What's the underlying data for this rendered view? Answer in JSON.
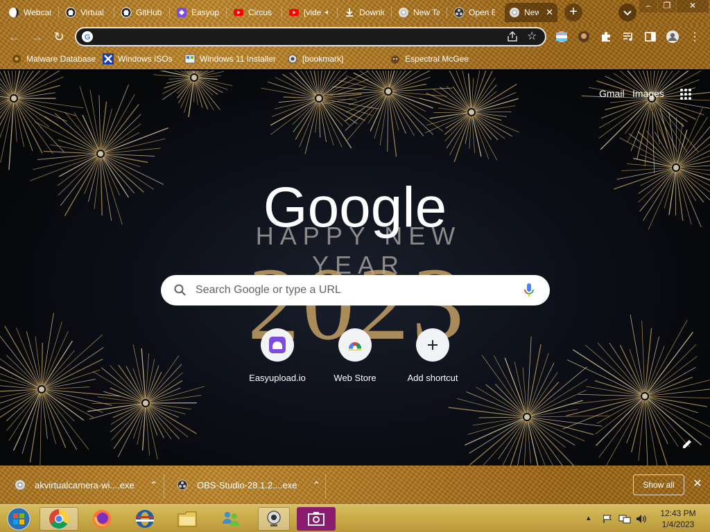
{
  "browser": {
    "tabs": [
      {
        "title": "Webcam",
        "icon": "webcam-favicon",
        "active": false
      },
      {
        "title": "Virtual",
        "icon": "github-icon",
        "active": false
      },
      {
        "title": "GitHub",
        "icon": "github-icon",
        "active": false
      },
      {
        "title": "Easyupl",
        "icon": "easyupload-icon",
        "active": false
      },
      {
        "title": "Circus",
        "icon": "youtube-icon",
        "active": false
      },
      {
        "title": "[video]",
        "icon": "youtube-icon",
        "active": false,
        "audio": true
      },
      {
        "title": "Downlo",
        "icon": "download-icon",
        "active": false
      },
      {
        "title": "New Ta",
        "icon": "chrome-icon",
        "active": false
      },
      {
        "title": "Open B",
        "icon": "obs-icon",
        "active": false
      },
      {
        "title": "New",
        "icon": "chrome-icon",
        "active": true
      }
    ],
    "omnibox_value": "",
    "bookmarks": [
      {
        "label": "Malware Database",
        "icon": "malware-icon"
      },
      {
        "label": "Windows ISOs",
        "icon": "x-icon"
      },
      {
        "label": "Windows 11 Installer",
        "icon": "installer-icon"
      },
      {
        "label": "[bookmark]",
        "icon": "gear-icon"
      },
      {
        "label": "Espectral McGee",
        "icon": "mcgee-icon"
      }
    ]
  },
  "ntp": {
    "top_links": {
      "gmail": "Gmail",
      "images": "Images"
    },
    "doodle": {
      "logo_text": "Google",
      "greeting": "HAPPY NEW YEAR",
      "year": "2023"
    },
    "search_placeholder": "Search Google or type a URL",
    "shortcuts": [
      {
        "label": "Easyupload.io",
        "icon": "easyupload-icon"
      },
      {
        "label": "Web Store",
        "icon": "webstore-icon"
      },
      {
        "label": "Add shortcut",
        "icon": "plus-icon"
      }
    ]
  },
  "downloads": {
    "items": [
      {
        "filename": "akvirtualcamera-wi....exe",
        "icon": "installer-file-icon"
      },
      {
        "filename": "OBS-Studio-28.1.2....exe",
        "icon": "obs-icon"
      }
    ],
    "show_all": "Show all"
  },
  "taskbar": {
    "apps": [
      "start-orb",
      "chrome",
      "firefox",
      "opera",
      "file-explorer",
      "people",
      "webcam",
      "camera-app"
    ],
    "clock": {
      "time": "12:43 PM",
      "date": "1/4/2023"
    }
  },
  "colors": {
    "theme_brown": "#a8721f",
    "taskbar_gold": "#c9ab48",
    "search_bg": "#ffffff"
  }
}
